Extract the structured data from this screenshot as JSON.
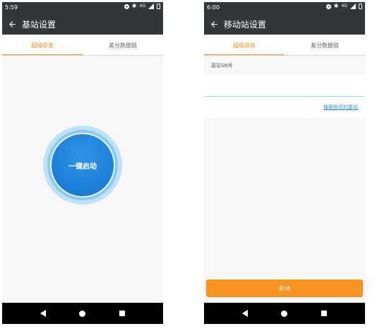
{
  "left": {
    "status": {
      "time": "5:59",
      "network": "4G"
    },
    "appbar": {
      "title": "基站设置"
    },
    "tabs": [
      {
        "label": "超级双发",
        "active": true
      },
      {
        "label": "差分数据链",
        "active": false
      }
    ],
    "start_button": "一键启动"
  },
  "right": {
    "status": {
      "time": "6:00",
      "network": "4G"
    },
    "appbar": {
      "title": "移动站设置"
    },
    "tabs": [
      {
        "label": "超级双收",
        "active": true
      },
      {
        "label": "差分数据链",
        "active": false
      }
    ],
    "sn_label": "基站SN号",
    "sn_value": "",
    "search_link": "搜索附近的基站",
    "launch_button": "启动"
  },
  "colors": {
    "accent": "#f28c1b",
    "appbar": "#33373a",
    "link": "#2a8fcf",
    "start_blue": "#1c7ed8"
  }
}
